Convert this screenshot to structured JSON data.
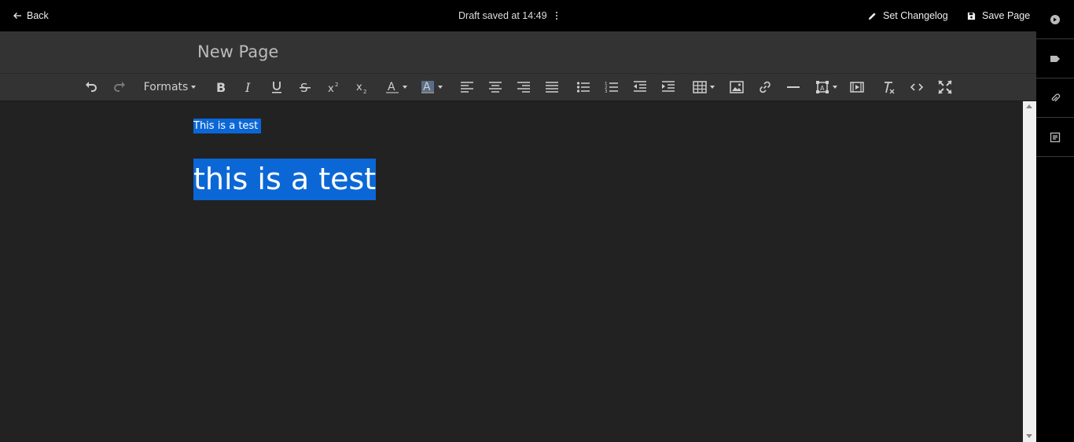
{
  "topbar": {
    "back_label": "Back",
    "draft_status": "Draft saved at 14:49",
    "set_changelog_label": "Set Changelog",
    "save_page_label": "Save Page"
  },
  "title": "New Page",
  "toolbar": {
    "formats_label": "Formats",
    "icons": [
      "undo-icon",
      "redo-icon",
      "bold-icon",
      "italic-icon",
      "underline-icon",
      "strikethrough-icon",
      "superscript-icon",
      "subscript-icon",
      "text-color-icon",
      "highlight-color-icon",
      "align-left-icon",
      "align-center-icon",
      "align-right-icon",
      "justify-icon",
      "bullet-list-icon",
      "numbered-list-icon",
      "outdent-icon",
      "indent-icon",
      "table-icon",
      "image-icon",
      "link-icon",
      "horizontal-rule-icon",
      "media-icon",
      "embed-icon",
      "clear-formatting-icon",
      "source-code-icon",
      "fullscreen-icon"
    ]
  },
  "content": {
    "line1": "This is a test",
    "line2": "this is a test"
  },
  "rail_icons": [
    "navigation-icon",
    "tag-icon",
    "attachment-icon",
    "template-icon"
  ],
  "colors": {
    "selection": "#0b67d6",
    "editor_bg": "#222222",
    "toolbar_bg": "#333333",
    "topbar_bg": "#000000"
  }
}
